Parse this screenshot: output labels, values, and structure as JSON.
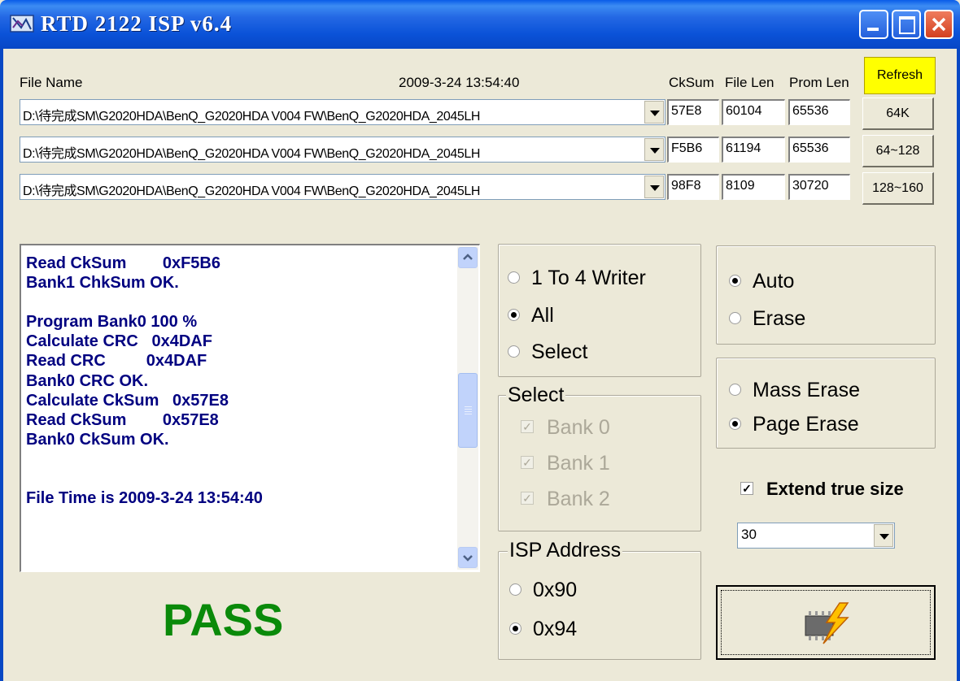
{
  "window": {
    "title": "RTD  2122  ISP  v6.4"
  },
  "header": {
    "file_name_label": "File Name",
    "file_time": "2009-3-24 13:54:40",
    "cksum_label": "CkSum",
    "file_len_label": "File Len",
    "prom_len_label": "Prom Len"
  },
  "files": [
    {
      "path": "D:\\待完成SM\\G2020HDA\\BenQ_G2020HDA V004 FW\\BenQ_G2020HDA_2045LH",
      "cksum": "57E8",
      "file_len": "60104",
      "prom_len": "65536"
    },
    {
      "path": "D:\\待完成SM\\G2020HDA\\BenQ_G2020HDA V004 FW\\BenQ_G2020HDA_2045LH",
      "cksum": "F5B6",
      "file_len": "61194",
      "prom_len": "65536"
    },
    {
      "path": "D:\\待完成SM\\G2020HDA\\BenQ_G2020HDA V004 FW\\BenQ_G2020HDA_2045LH",
      "cksum": "98F8",
      "file_len": "8109",
      "prom_len": "30720"
    }
  ],
  "side_buttons": {
    "refresh": "Refresh",
    "b64k": "64K",
    "b64_128": "64~128",
    "b128_160": "128~160"
  },
  "log": {
    "lines": [
      "Read CkSum        0xF5B6",
      "Bank1 ChkSum OK.",
      "",
      "Program Bank0 100 %",
      "Calculate CRC   0x4DAF",
      "Read CRC         0x4DAF",
      "Bank0 CRC OK.",
      "Calculate CkSum   0x57E8",
      "Read CkSum        0x57E8",
      "Bank0 CkSum OK.",
      "",
      "",
      "File Time is 2009-3-24 13:54:40"
    ]
  },
  "status": "PASS",
  "writer_mode": {
    "options": [
      "1 To 4 Writer",
      "All",
      "Select"
    ],
    "selected": "All"
  },
  "select_group": {
    "legend": "Select",
    "banks": [
      "Bank 0",
      "Bank 1",
      "Bank 2"
    ]
  },
  "isp_address": {
    "legend": "ISP Address",
    "options": [
      "0x90",
      "0x94"
    ],
    "selected": "0x94"
  },
  "erase_mode": {
    "options": [
      "Auto",
      "Erase"
    ],
    "selected": "Auto"
  },
  "erase_type": {
    "options": [
      "Mass Erase",
      "Page Erase"
    ],
    "selected": "Page Erase"
  },
  "extend": {
    "label": "Extend true size",
    "checked": true
  },
  "size_select": {
    "value": "30"
  },
  "colors": {
    "accent_title": "#0a5ce8",
    "log_text": "#000080",
    "pass": "#0a8a0a",
    "refresh_bg": "#ffff00"
  },
  "icons": {
    "program_button": "lightning-chip-icon"
  }
}
